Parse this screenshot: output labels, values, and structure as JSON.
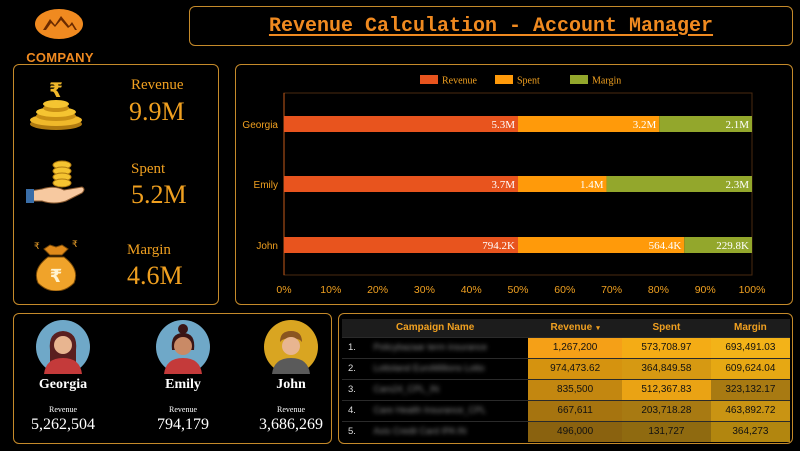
{
  "logo": {
    "text": "COMPANY"
  },
  "title": "Revenue Calculation - Account Manager",
  "kpis": [
    {
      "label": "Revenue",
      "value": "9.9M",
      "icon": "rupee-coin-stack-icon"
    },
    {
      "label": "Spent",
      "value": "5.2M",
      "icon": "hand-holding-coins-icon"
    },
    {
      "label": "Margin",
      "value": "4.6M",
      "icon": "rupee-money-bag-icon"
    }
  ],
  "chart_data": {
    "type": "bar",
    "orientation": "horizontal",
    "stacked": "percent",
    "categories": [
      "Georgia",
      "Emily",
      "John"
    ],
    "series": [
      {
        "name": "Revenue",
        "color": "#e8541e",
        "values": [
          5.3,
          3.7,
          0.7942
        ],
        "labels": [
          "5.3M",
          "3.7M",
          "794.2K"
        ]
      },
      {
        "name": "Spent",
        "color": "#ff9a0a",
        "values": [
          3.2,
          1.4,
          0.5644
        ],
        "labels": [
          "3.2M",
          "1.4M",
          "564.4K"
        ]
      },
      {
        "name": "Margin",
        "color": "#93a72c",
        "values": [
          2.1,
          2.3,
          0.2298
        ],
        "labels": [
          "2.1M",
          "2.3M",
          "229.8K"
        ]
      }
    ],
    "xticks": [
      "0%",
      "10%",
      "20%",
      "30%",
      "40%",
      "50%",
      "60%",
      "70%",
      "80%",
      "90%",
      "100%"
    ],
    "xlim": [
      0,
      100
    ],
    "legend": "top-center",
    "grid": false
  },
  "people": [
    {
      "name": "Georgia",
      "revenue_label": "Revenue",
      "revenue": "5,262,504",
      "avatar_bg": "#6fa8c8"
    },
    {
      "name": "Emily",
      "revenue_label": "Revenue",
      "revenue": "794,179",
      "avatar_bg": "#6fa8c8"
    },
    {
      "name": "John",
      "revenue_label": "Revenue",
      "revenue": "3,686,269",
      "avatar_bg": "#d9a521"
    }
  ],
  "table": {
    "headers": [
      "Campaign Name",
      "Revenue",
      "Spent",
      "Margin"
    ],
    "sort_indicator": "▾",
    "rows": [
      {
        "idx": "1.",
        "name": "Policybazaar term insurance",
        "revenue": "1,267,200",
        "spent": "573,708.97",
        "margin": "693,491.03",
        "rev_bg": "#f5a017",
        "spent_bg": "#f4ac15",
        "margin_bg": "#f3b318"
      },
      {
        "idx": "2.",
        "name": "Lottoland EuroMillions Lotto",
        "revenue": "974,473.62",
        "spent": "364,849.58",
        "margin": "609,624.04",
        "rev_bg": "#d5930f",
        "spent_bg": "#d69912",
        "margin_bg": "#e6a813"
      },
      {
        "idx": "3.",
        "name": "Cars24_CPL_IN",
        "revenue": "835,500",
        "spent": "512,367.83",
        "margin": "323,132.17",
        "rev_bg": "#c38710",
        "spent_bg": "#eaa314",
        "margin_bg": "#a87a12"
      },
      {
        "idx": "4.",
        "name": "Care Health Insurance_CPL",
        "revenue": "667,611",
        "spent": "203,718.28",
        "margin": "463,892.72",
        "rev_bg": "#a6740f",
        "spent_bg": "#a87a12",
        "margin_bg": "#c99413"
      },
      {
        "idx": "5.",
        "name": "Axis Credit Card IPA IN",
        "revenue": "496,000",
        "spent": "131,727",
        "margin": "364,273",
        "rev_bg": "#8a620f",
        "spent_bg": "#8f6a10",
        "margin_bg": "#b2860f"
      }
    ]
  }
}
